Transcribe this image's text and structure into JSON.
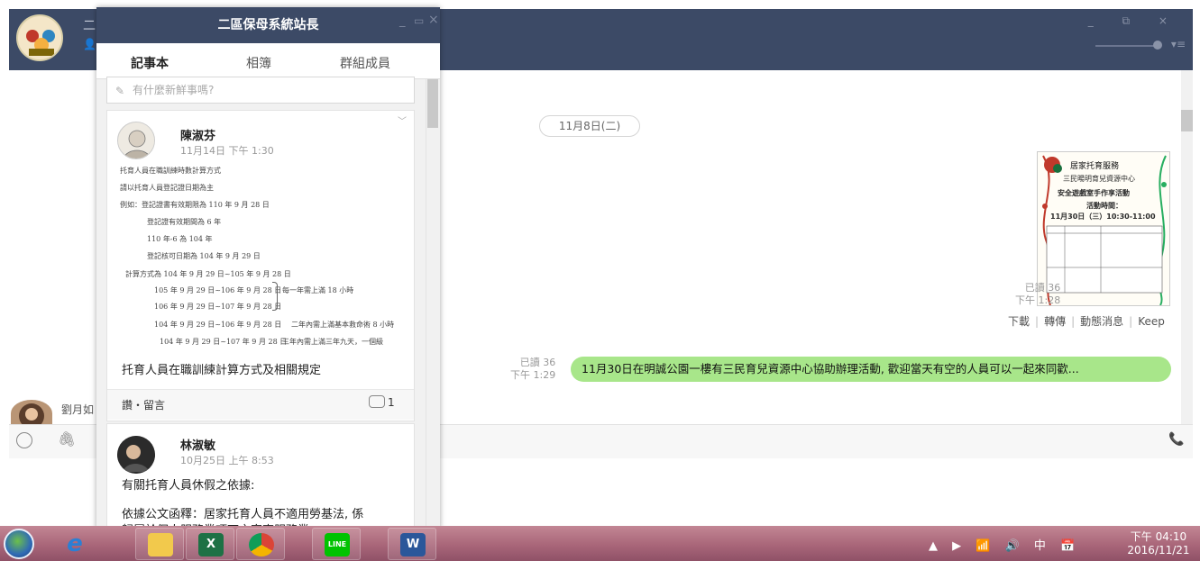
{
  "main_window": {
    "title_partial": "二",
    "controls": "_ ⧉ ×",
    "date_divider": "11月8日(二)",
    "image_message": {
      "read": "已讀 36",
      "time": "下午 1:28",
      "actions": [
        "下載",
        "轉傳",
        "動態消息",
        "Keep"
      ],
      "poster_lines": [
        "居家托育服務",
        "三民暘明育兒資源中心",
        "安全遊戲室手作享活動",
        "活動時間：",
        "11月30日（三）10:30-11:00"
      ]
    },
    "text_message": {
      "read": "已讀 36",
      "time": "下午 1:29",
      "text": "11月30日在明誠公園一樓有三民育兒資源中心協助辦理活動, 歡迎當天有空的人員可以一起來同歡..."
    },
    "peek_member_name": "劉月如"
  },
  "album": {
    "title": "二區保母系統站長",
    "tabs": [
      "記事本",
      "相簿",
      "群組成員"
    ],
    "post_placeholder": "有什麼新鮮事嗎?",
    "post1": {
      "author": "陳淑芬",
      "time": "11月14日 下午 1:30",
      "doc_lines": [
        "托育人員在職訓練時數計算方式",
        "請以托育人員登記證日期為主",
        "例如：登記證書有效期限為 110 年 9 月 28 日",
        "登記證有效期間為 6 年",
        "110 年-6 為 104 年",
        "登記核可日期為 104 年 9 月 29 日",
        "計算方式為 104 年 9 月 29 日~105 年 9 月 28 日",
        "105 年 9 月 29 日~106 年 9 月 28 日",
        "106 年 9 月 29 日~107 年 9 月 28 日",
        "每一年需上滿 18 小時",
        "104 年 9 月 29 日~106 年 9 月 28 日",
        "二年內需上滿基本救命術 8 小時",
        "104 年 9 月 29 日~107 年 9 月 28 日",
        "三年內需上滿三年九天，一個級"
      ],
      "caption": "托育人員在職訓練計算方式及相關規定",
      "like": "讚・留言",
      "comment_count": "1"
    },
    "post2": {
      "author": "林淑敏",
      "time": "10月25日 上午 8:53",
      "line1": "有關托育人員休假之依據:",
      "line2": "依據公文函釋：居家托育人員不適用勞基法, 係",
      "line3": "歸屬於個人服務業項下之家事服務業"
    }
  },
  "taskbar": {
    "tray": "▲ ▶ 📶 🔊 中 📅",
    "clock_time": "下午 04:10",
    "clock_date": "2016/11/21"
  }
}
